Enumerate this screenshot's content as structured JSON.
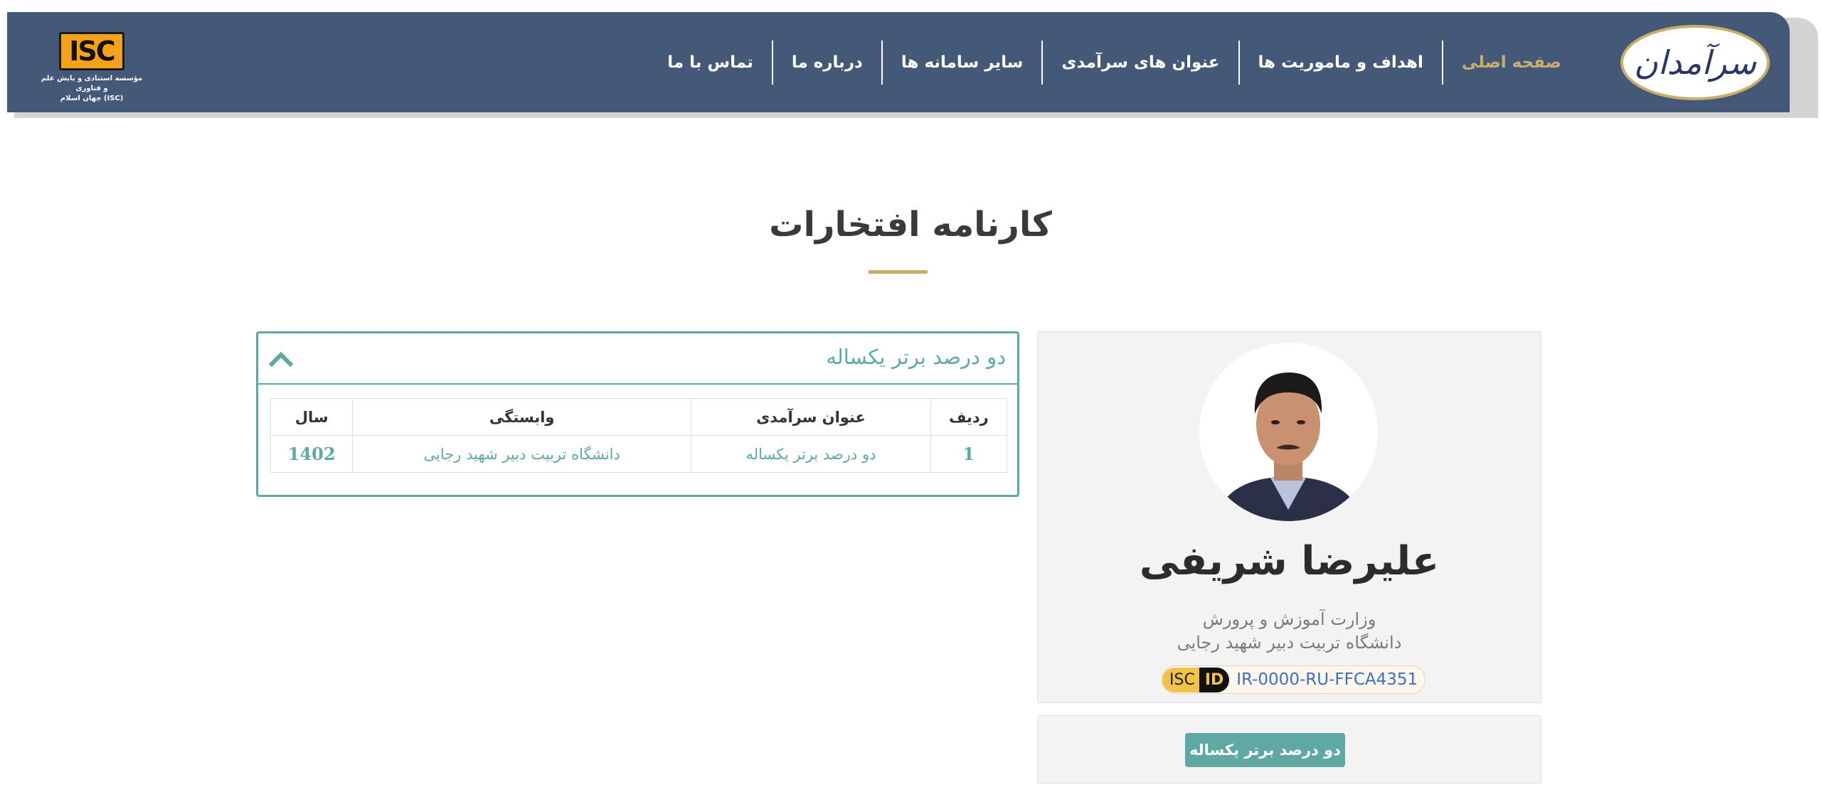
{
  "header": {
    "brand_text": "سرآمدان",
    "nav": [
      {
        "label": "صفحه اصلی",
        "active": true
      },
      {
        "label": "اهداف و ماموریت ها",
        "active": false
      },
      {
        "label": "عنوان های سرآمدی",
        "active": false
      },
      {
        "label": "سایر سامانه ها",
        "active": false
      },
      {
        "label": "درباره ما",
        "active": false
      },
      {
        "label": "تماس با ما",
        "active": false
      }
    ],
    "isc_logo_text": "ISC",
    "isc_caption_line1": "مؤسسه استنادی و پایش علم و فناوری",
    "isc_caption_line2": "جهان اسلام (ISC)"
  },
  "page": {
    "title": "کارنامه افتخارات",
    "accent_color": "#c9ae6b",
    "teal_color": "#5fa8a3",
    "header_color": "#445878"
  },
  "profile": {
    "name": "علیرضا شریفی",
    "affiliation_line1": "وزارت آموزش و پرورش",
    "affiliation_line2": "دانشگاه تربیت دبیر شهید رجایی",
    "isc_tag": "ISC",
    "id_tag": "ID",
    "isc_id": "IR-0000-RU-FFCA4351"
  },
  "badges": [
    {
      "label": "دو درصد برتر یکساله"
    }
  ],
  "awards_panel": {
    "title": "دو درصد برتر یکساله",
    "columns": [
      "ردیف",
      "عنوان سرآمدی",
      "وابستگی",
      "سال"
    ],
    "rows": [
      [
        "1",
        "دو درصد برتر یکساله",
        "دانشگاه تربیت دبیر شهید رجایی",
        "1402"
      ]
    ]
  }
}
